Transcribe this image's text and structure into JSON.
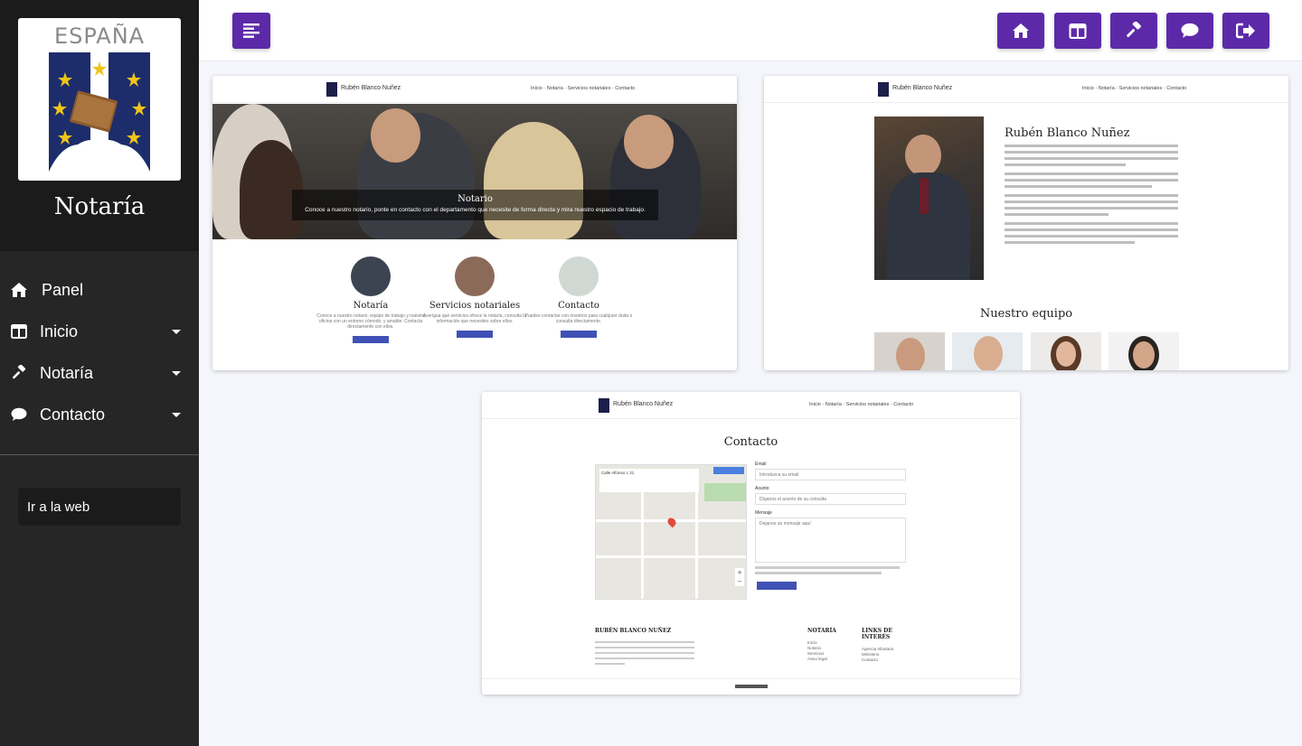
{
  "sidebar": {
    "logo_text": "ESPAÑA",
    "brand_title": "Notaría",
    "items": [
      {
        "label": "Panel",
        "icon": "home-icon",
        "has_caret": false
      },
      {
        "label": "Inicio",
        "icon": "columns-icon",
        "has_caret": true
      },
      {
        "label": "Notaría",
        "icon": "gavel-icon",
        "has_caret": true
      },
      {
        "label": "Contacto",
        "icon": "comment-icon",
        "has_caret": true
      }
    ],
    "web_button": "Ir a la web"
  },
  "topbar": {
    "menu_toggle_icon": "align-left-icon",
    "actions": [
      "home-icon",
      "columns-icon",
      "gavel-icon",
      "comment-icon",
      "sign-out-icon"
    ]
  },
  "colors": {
    "accent": "#5c2aa8",
    "sidebar_bg": "#262626",
    "brand_bg": "#1b1b1b",
    "mini_button": "#3f51b5"
  },
  "cards": {
    "home": {
      "brand": "Rubén Blanco Nuñez",
      "nav_links": "Inicio · Notaría · Servicios notariales · Contacto",
      "hero_title": "Notario",
      "hero_sub": "Conoce a nuestro notario, ponte en contacto con el departamento que necesite de forma directa y mira nuestro espacio de trabajo.",
      "features": [
        {
          "title": "Notaría",
          "text": "Conoce a nuestro notario, equipo de trabajo y nuestra oficina con un entorno cómodo, y amable. Contacta directamente con ellos.",
          "button": "VER MÁS"
        },
        {
          "title": "Servicios notariales",
          "text": "Averigua qué servicios ofrece la notaría, consulta la información que necesites sobre ellos.",
          "button": "VER MÁS"
        },
        {
          "title": "Contacto",
          "text": "Puedes contactar con nosotros para cualquier duda o consulta directamente.",
          "button": "VER MÁS"
        }
      ]
    },
    "about": {
      "brand": "Rubén Blanco Nuñez",
      "nav_links": "Inicio · Notaría · Servicios notariales · Contacto",
      "name": "Rubén Blanco Nuñez",
      "team_title": "Nuestro equipo"
    },
    "contact": {
      "brand": "Rubén Blanco Nuñez",
      "nav_links": "Inicio · Notaría · Servicios notariales · Contacto",
      "title": "Contacto",
      "map_address": "Calle Alfonso I, 21",
      "email_label": "Email",
      "email_placeholder": "Introduzca su email",
      "subject_label": "Asunto",
      "subject_placeholder": "Díganos el asunto de su consulta",
      "message_label": "Mensaje",
      "message_placeholder": "Dejanos un mensaje aquí",
      "submit": "ENVIAR CONSULTA",
      "footer_brand": "RUBÉN BLANCO NUÑEZ",
      "footer_col2": "NOTARÍA",
      "footer_col3": "LINKS DE INTERÉS",
      "footer_links2": [
        "Inicio",
        "Notaría",
        "Servicios",
        "Aviso legal"
      ],
      "footer_links3": [
        "Agencia tributaria",
        "Ministerio",
        "Contacto"
      ]
    }
  }
}
